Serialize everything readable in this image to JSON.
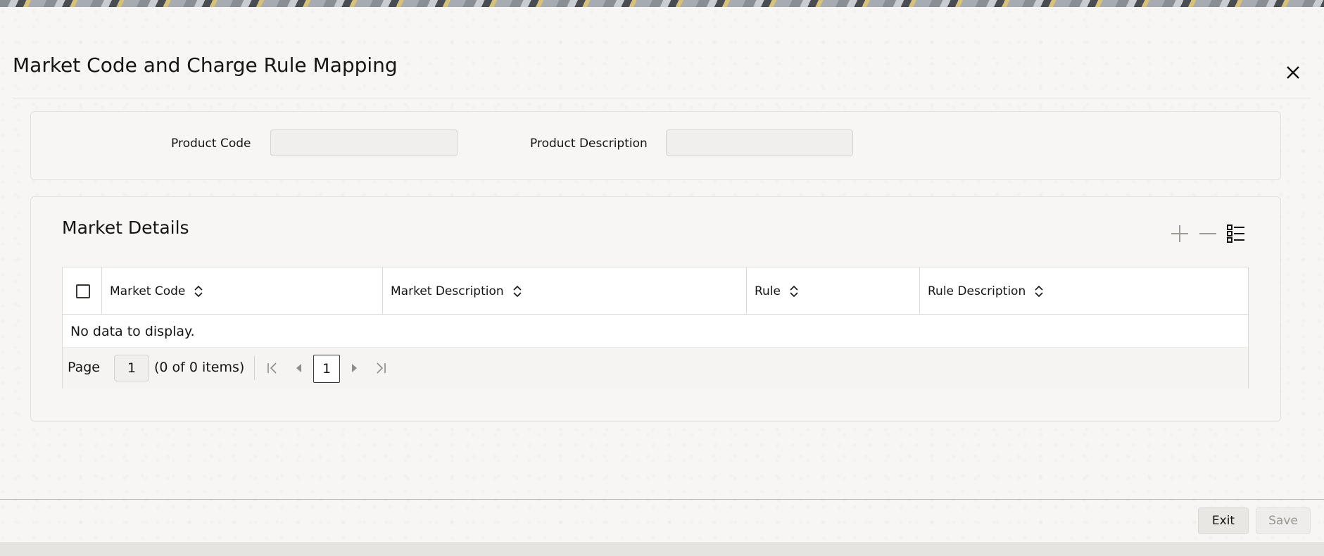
{
  "window": {
    "title": "Market Code and Charge Rule Mapping",
    "close_icon": "close-icon"
  },
  "form": {
    "product_code_label": "Product Code",
    "product_code_value": "",
    "product_description_label": "Product Description",
    "product_description_value": ""
  },
  "market_details": {
    "title": "Market Details",
    "tools": [
      "add-icon",
      "remove-icon",
      "column-list-icon"
    ],
    "columns": [
      {
        "label": "Market Code"
      },
      {
        "label": "Market Description"
      },
      {
        "label": "Rule"
      },
      {
        "label": "Rule Description"
      }
    ],
    "empty_message": "No data to display.",
    "pager": {
      "page_label": "Page",
      "page_value": "1",
      "items_text": "(0 of 0 items)",
      "current_page": "1"
    }
  },
  "footer": {
    "exit_label": "Exit",
    "save_label": "Save"
  },
  "colors": {
    "text": "#161513",
    "disabled_text": "#9a9792",
    "panel_background": "#f7f6f4",
    "border": "#dcdad6"
  }
}
